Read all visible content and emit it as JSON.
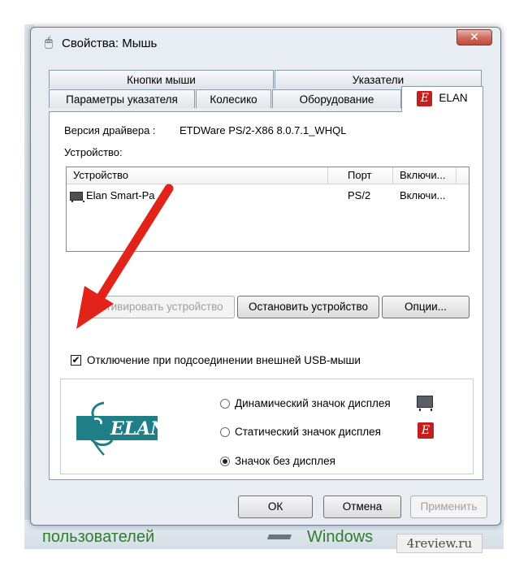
{
  "window": {
    "title": "Свойства: Мышь",
    "close_label": "✕"
  },
  "tabs": {
    "row1": [
      "Кнопки мыши",
      "Указатели"
    ],
    "row2": [
      "Параметры указателя",
      "Колесико",
      "Оборудование",
      "ELAN"
    ],
    "active": "ELAN"
  },
  "panel": {
    "driver_label": "Версия драйвера :",
    "driver_value": "ETDWare PS/2-X86 8.0.7.1_WHQL",
    "device_label": "Устройство:",
    "table": {
      "headers": [
        "Устройство",
        "Порт",
        "Включи..."
      ],
      "rows": [
        [
          "Elan Smart-Pa",
          "PS/2",
          "Включи..."
        ]
      ]
    },
    "buttons": {
      "activate": "Активировать устройство",
      "stop": "Остановить устройство",
      "options": "Опции..."
    },
    "checkbox": {
      "label": "Отключение при подсоединении внешней USB-мыши",
      "checked": true
    },
    "logo_text": "ELAN",
    "radios": [
      {
        "label": "Динамический значок дисплея",
        "checked": false,
        "icon": "dynamic-tray-icon"
      },
      {
        "label": "Статический значок дисплея",
        "checked": false,
        "icon": "static-elan-icon"
      },
      {
        "label": "Значок без дисплея",
        "checked": true
      }
    ]
  },
  "footer": {
    "ok": "ОК",
    "cancel": "Отмена",
    "apply": "Применить"
  },
  "background": {
    "text_left": "пользователей",
    "text_right": "Windows",
    "watermark": "4review.ru"
  },
  "colors": {
    "elan_red": "#c41e1e",
    "logo_teal": "#1f7f86",
    "arrow_red": "#e2231a"
  }
}
